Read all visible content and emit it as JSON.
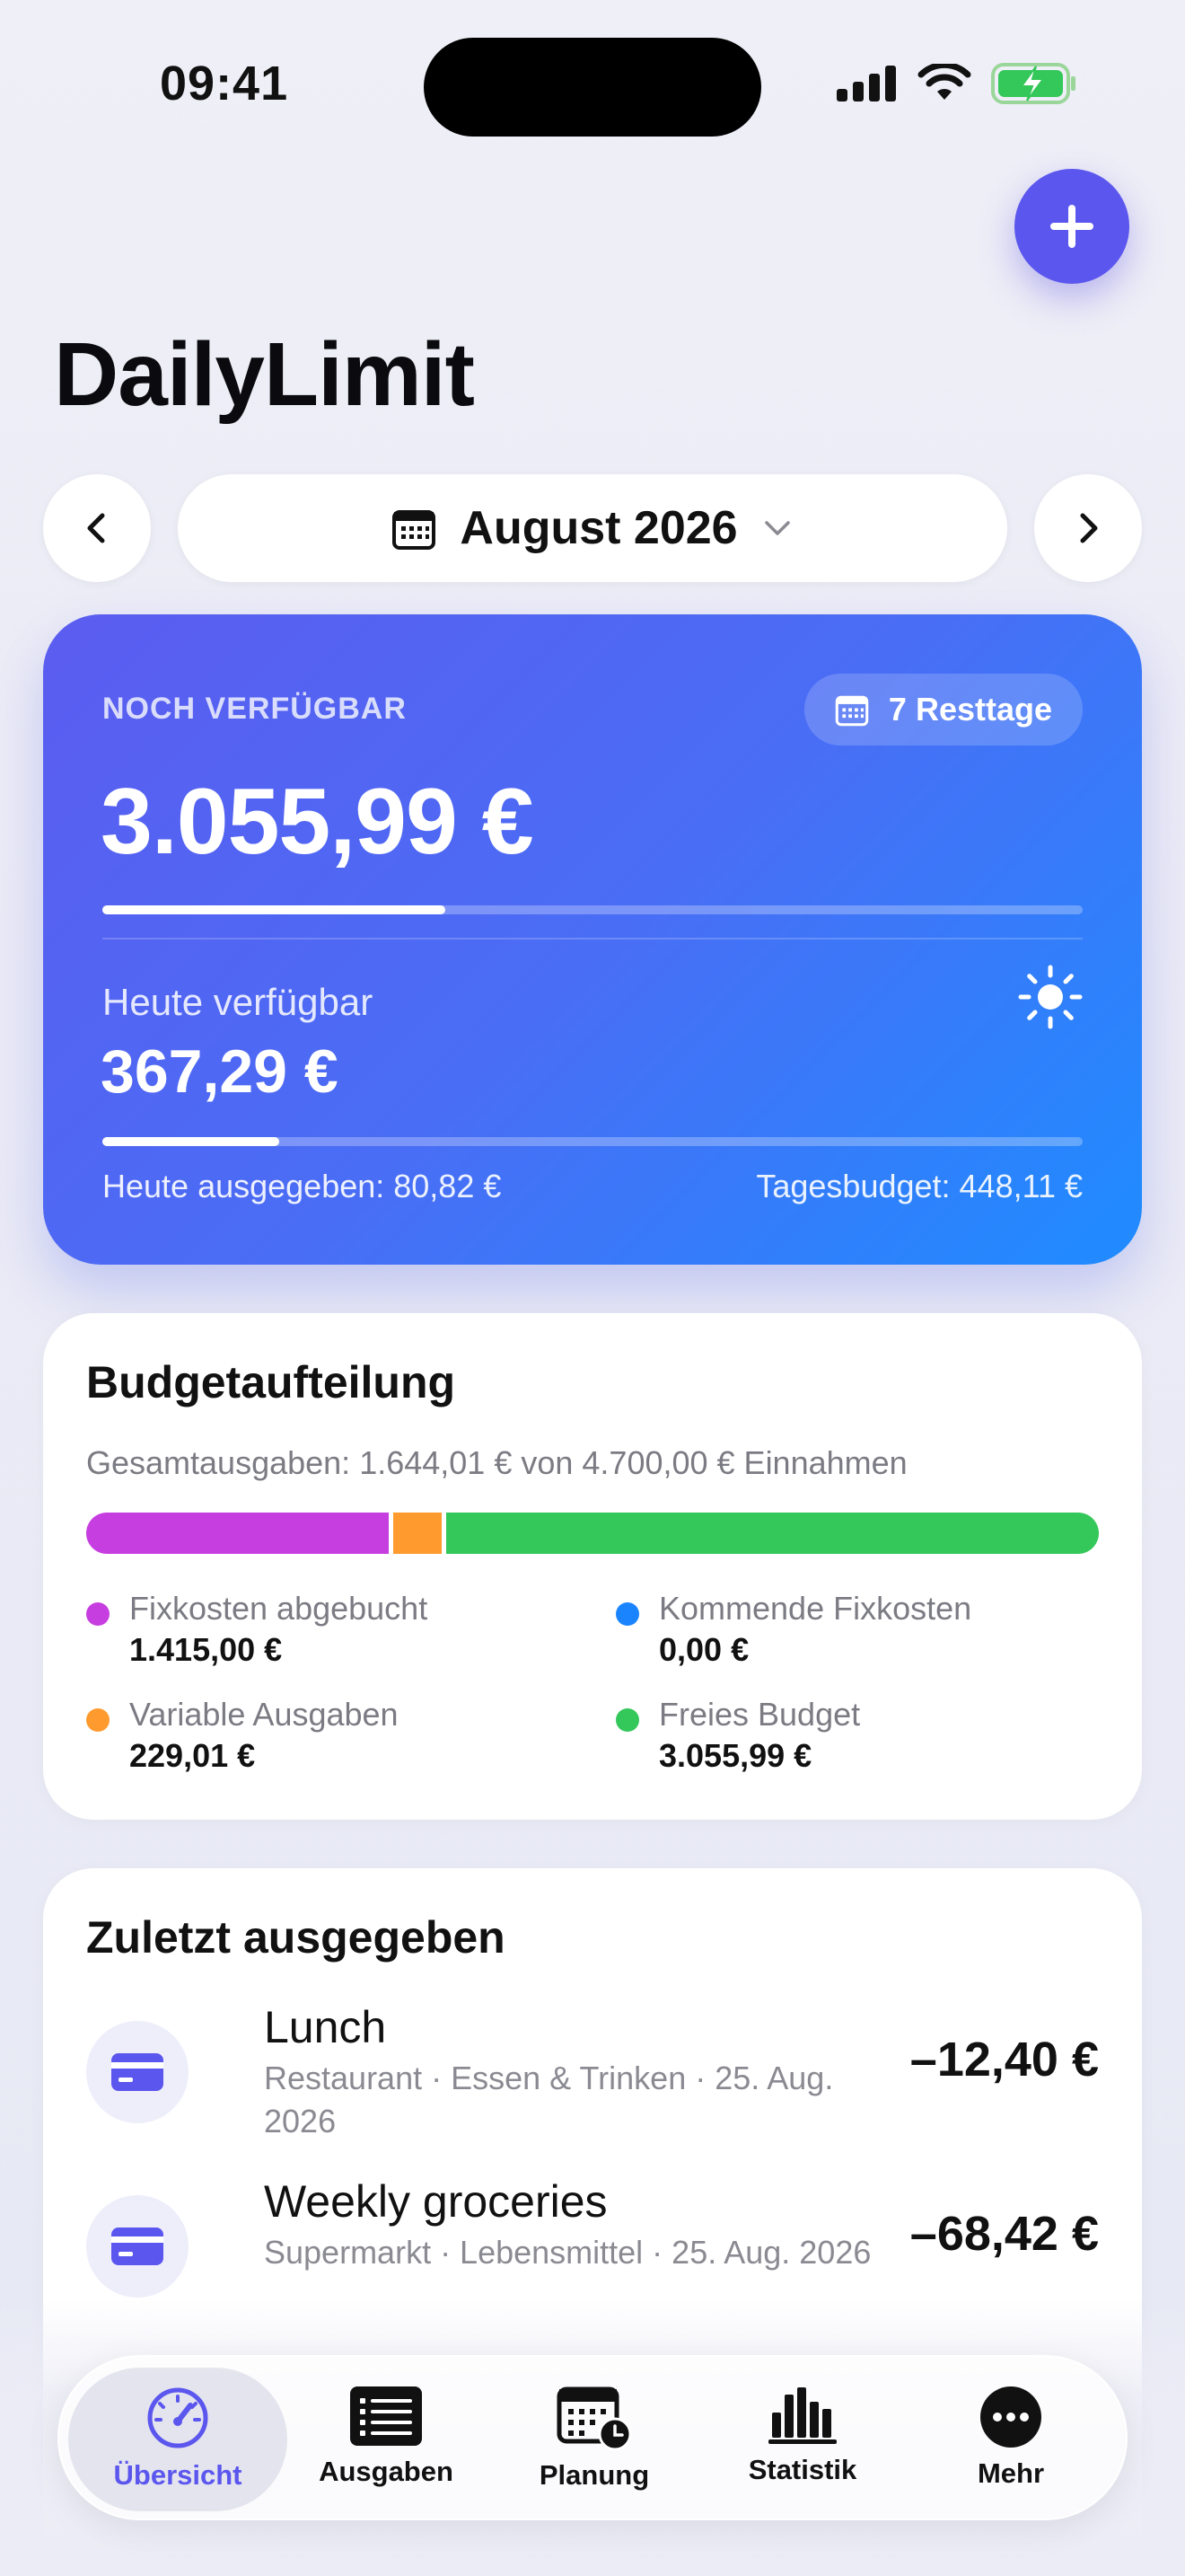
{
  "status_bar": {
    "time": "09:41"
  },
  "header": {
    "title": "DailyLimit",
    "add_button_icon": "plus-icon"
  },
  "month_selector": {
    "label": "August 2026"
  },
  "available_card": {
    "label": "NOCH VERFÜGBAR",
    "remaining_days": "7 Resttage",
    "amount": "3.055,99 €",
    "month_progress": 0.35,
    "today_label": "Heute verfügbar",
    "today_amount": "367,29 €",
    "today_progress": 0.18,
    "spent_today": "Heute ausgegeben: 80,82 €",
    "daily_budget": "Tagesbudget: 448,11 €"
  },
  "budget_split": {
    "title": "Budgetaufteilung",
    "subtitle": "Gesamtausgaben: 1.644,01 € von 4.700,00 € Einnahmen",
    "segments": [
      {
        "value": 1415.0,
        "color": "#c73ee0"
      },
      {
        "value": 229.01,
        "color": "#ff9a2e"
      },
      {
        "value": 3055.99,
        "color": "#34c759"
      }
    ],
    "legend": [
      {
        "name": "Fixkosten abgebucht",
        "value": "1.415,00 €",
        "color": "#c73ee0"
      },
      {
        "name": "Kommende Fixkosten",
        "value": "0,00 €",
        "color": "#1a84ff"
      },
      {
        "name": "Variable Ausgaben",
        "value": "229,01 €",
        "color": "#ff9a2e"
      },
      {
        "name": "Freies Budget",
        "value": "3.055,99 €",
        "color": "#34c759"
      }
    ]
  },
  "recent": {
    "title": "Zuletzt ausgegeben",
    "items": [
      {
        "name": "Lunch",
        "meta": "Restaurant · Essen & Trinken · 25. Aug. 2026",
        "amount": "–12,40 €"
      },
      {
        "name": "Weekly groceries",
        "meta": "Supermarkt · Lebensmittel · 25. Aug. 2026",
        "amount": "–68,42 €"
      }
    ]
  },
  "tabbar": {
    "tabs": [
      {
        "label": "Übersicht",
        "icon": "speedometer-icon",
        "active": true
      },
      {
        "label": "Ausgaben",
        "icon": "list-icon"
      },
      {
        "label": "Planung",
        "icon": "calendar-clock-icon"
      },
      {
        "label": "Statistik",
        "icon": "bar-chart-icon"
      },
      {
        "label": "Mehr",
        "icon": "more-icon"
      }
    ]
  }
}
